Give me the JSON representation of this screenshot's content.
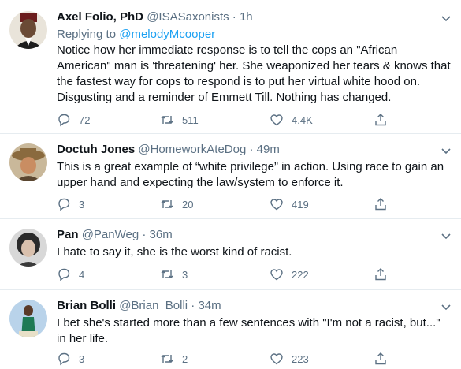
{
  "tweets": [
    {
      "name": "Axel Folio, PhD",
      "handle": "@ISASaxonists",
      "time": "1h",
      "reply_prefix": "Replying to",
      "reply_to": "@melodyMcooper",
      "text": "Notice how her immediate response is to tell the cops an \"African American\" man is 'threatening' her. She weaponized her tears & knows that the fastest way for cops to respond is to put her virtual white hood on. Disgusting and a reminder of Emmett Till. Nothing has changed.",
      "replies": "72",
      "retweets": "511",
      "likes": "4.4K"
    },
    {
      "name": "Doctuh Jones",
      "handle": "@HomeworkAteDog",
      "time": "49m",
      "text": "This is a great example of “white privilege” in action. Using race to gain an upper hand and expecting the law/system to enforce it.",
      "replies": "3",
      "retweets": "20",
      "likes": "419"
    },
    {
      "name": "Pan",
      "handle": "@PanWeg",
      "time": "36m",
      "text": "I hate to say it, she is the worst kind of racist.",
      "replies": "4",
      "retweets": "3",
      "likes": "222"
    },
    {
      "name": "Brian Bolli",
      "handle": "@Brian_Bolli",
      "time": "34m",
      "text": "I bet she's started more than a few sentences with \"I'm not a racist, but...\" in her life.",
      "replies": "3",
      "retweets": "2",
      "likes": "223"
    }
  ],
  "separator": "·",
  "colors": {
    "link": "#1da1f2",
    "muted": "#5b7083",
    "text": "#0f1419",
    "border": "#e6ecf0"
  }
}
